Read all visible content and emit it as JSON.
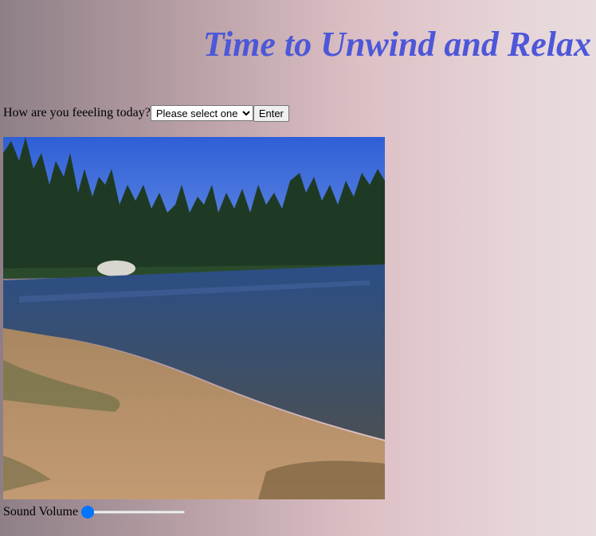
{
  "header": {
    "title": "Time to Unwind and Relax"
  },
  "mood": {
    "label": "How are you feeeling today?",
    "select_value": "Please select one",
    "enter_label": "Enter"
  },
  "scene": {
    "icon": "lake-landscape-image"
  },
  "volume": {
    "label": "Sound Volume",
    "level": 0
  },
  "colors": {
    "title": "#4d57d8",
    "slider_accent": "#0075ff"
  }
}
